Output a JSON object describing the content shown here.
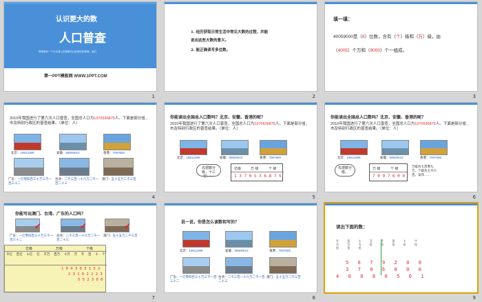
{
  "slides": [
    {
      "num": "1",
      "title_top": "认识更大的数",
      "title_main": "人口普查",
      "subtitle": "哥哥是有一个大功课上的事情可以的我们的事情，我们",
      "footer": "第一PPT模板网 WWW.1PPT.COM"
    },
    {
      "num": "2",
      "lines": [
        "1. 经历获取日常生活中常见大数的过程，并能",
        "说出这些大数的意义。",
        "2. 能正确读写多位数。"
      ]
    },
    {
      "num": "3",
      "heading": "填一填：",
      "line1_pre": "40059000是（",
      "a1": "8",
      "line1_mid": "）位数，含有（",
      "a2": "个",
      "line1_mid2": "）级和（",
      "a3": "万",
      "line1_post": "）级，由",
      "line2_pre": "（",
      "a4": "4005",
      "line2_mid": "）个万和（",
      "a5": "9000",
      "line2_post": "）个一组成。"
    },
    {
      "num": "4",
      "text_pre": "2010年我国进行了第六次人口普查，全国总人口为",
      "text_num": "1370536875",
      "text_post": "人。下面是部分省、市及特别行政区的普查结果。（单位：人）",
      "cap_bj": "北京：",
      "val_bj": "19612368",
      "cap_ah": "安徽：",
      "val_ah": "59500510",
      "cap_xg": "香港：",
      "val_xg": "7097600",
      "cap_gd": "广东：",
      "val_gd": "一亿零四百三十万三千一百三十二",
      "cap_tw": "台湾：",
      "val_tw": "二千三百一十六万二千一百二十三",
      "cap_am": "澳门：",
      "val_am": "五十五万二千三百"
    },
    {
      "num": "5",
      "q": "你能读出全国总人口数吗？北京、安徽、香港的呢？",
      "text_pre": "2010年我国进行了第六次人口普查，全国总人口为",
      "text_num": "1370536875",
      "text_post": "人。下面是部分省、市及特别行政区的普查结果。（单位：人）",
      "cap_bj": "北京：",
      "val_bj": "19612368",
      "cap_ah": "安徽：",
      "val_ah": "59500510",
      "cap_xg": "香港：",
      "val_xg": "7097600",
      "bubble": "先把数分级，十三亿……",
      "hdr1": "亿级",
      "hdr2": "万 级",
      "hdr3": "个 级",
      "digits": "1 3 7 0 5 3 6 8 7 5"
    },
    {
      "num": "6",
      "q": "你能读出全国总人口数吗？北京、安徽、香港的呢？",
      "text_pre": "2010年我国进行了第六次人口普查，全国总人口为",
      "text_num": "1370536875",
      "text_post": "人。下面是部分省、市及特别行政区的普查结果。（单位：人）",
      "cap_bj": "北京：",
      "val_bj": "19612368",
      "cap_ah": "安徽：",
      "val_ah": "59500510",
      "cap_xg": "香港：",
      "val_xg": "7097600",
      "bubble": "先把数分级。",
      "hdr2": "万 级",
      "hdr3": "个 级",
      "digits": "7 0 9 7 6 0 0",
      "note": "万级为七百零九万，个级为七千六百，读作……"
    },
    {
      "num": "7",
      "q": "你能写出澳门、台湾、广东的人口吗？",
      "cap_gd": "广东：",
      "val_gd": "一亿零四百三十万三千一百三十二",
      "cap_tw": "台湾：",
      "val_tw": "二千三百一十六万二千一百二十三",
      "cap_am": "澳门：",
      "val_am": "五十五万二千三百",
      "hdr_yi": "亿级",
      "hdr_wan": "万级",
      "hdr_ge": "个级",
      "cols": [
        "千亿",
        "百亿",
        "十亿",
        "亿",
        "千万",
        "百万",
        "十万",
        "万",
        "千",
        "百",
        "十",
        "个"
      ],
      "row1": "1 0 4 3 0 3 1 3 2",
      "row2": "2 3 1 6 2 1 2 3",
      "row3": "5 5 2 3 0 0"
    },
    {
      "num": "8",
      "q": "说一说，你是怎么读数和写的？",
      "cap_bj": "北京：",
      "val_bj": "19612368",
      "cap_ah": "安徽：",
      "val_ah": "59500510",
      "cap_xg": "香港：",
      "val_xg": "7097600",
      "cap_gd": "广东：",
      "val_gd": "一亿零四百三十万三千一百三十二",
      "cap_tw": "台湾：",
      "val_tw": "二千三百一十六万二千一百二十三",
      "cap_am": "澳门：",
      "val_am": "五十五万二千三百"
    },
    {
      "num": "9",
      "heading": "读出下面的数：",
      "col_labels": [
        "千万位",
        "百万位",
        "十万位",
        "万位",
        "千位",
        "百位",
        "十位",
        "个位"
      ],
      "row1": "5 6 7 9 2 0 0",
      "row2": "3 7 0 6 0 0 0",
      "row3": "4 0 0 8 0 5 0 1"
    }
  ],
  "colors": {
    "title_blue": "#4a90d9",
    "accent_red": "#e0242c",
    "value_blue": "#2a63c8",
    "selection": "#e0a000"
  }
}
